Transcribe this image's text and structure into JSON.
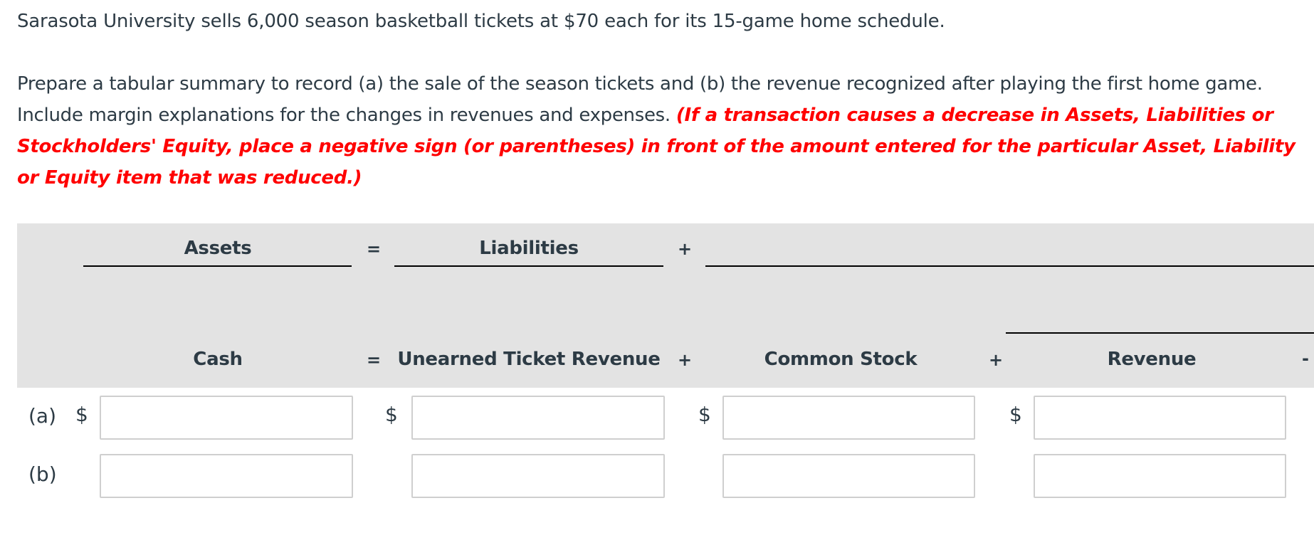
{
  "question": {
    "intro": "Sarasota University sells 6,000 season basketball tickets at $70 each for its 15-game home schedule.",
    "instruction": "Prepare a tabular summary to record (a) the sale of the season tickets and (b) the revenue recognized after playing the first home game. Include margin explanations for the changes in revenues and expenses.",
    "note": "(If a transaction causes a decrease in Assets, Liabilities or Stockholders' Equity, place a negative sign (or parentheses) in front of the amount entered for the particular Asset, Liability or Equity item that was reduced.)"
  },
  "table": {
    "top_headers": {
      "assets": "Assets",
      "equals": "=",
      "liabilities": "Liabilities",
      "plus": "+"
    },
    "columns": [
      {
        "label": "Cash",
        "operator_after": "="
      },
      {
        "label": "Unearned Ticket Revenue",
        "operator_after": "+"
      },
      {
        "label": "Common Stock",
        "operator_after": "+"
      },
      {
        "label": "Revenue",
        "operator_after": "-"
      }
    ],
    "currency_symbol": "$",
    "rows": [
      {
        "label": "(a)",
        "values": [
          "",
          "",
          "",
          ""
        ]
      },
      {
        "label": "(b)",
        "values": [
          "",
          "",
          "",
          ""
        ]
      }
    ]
  }
}
